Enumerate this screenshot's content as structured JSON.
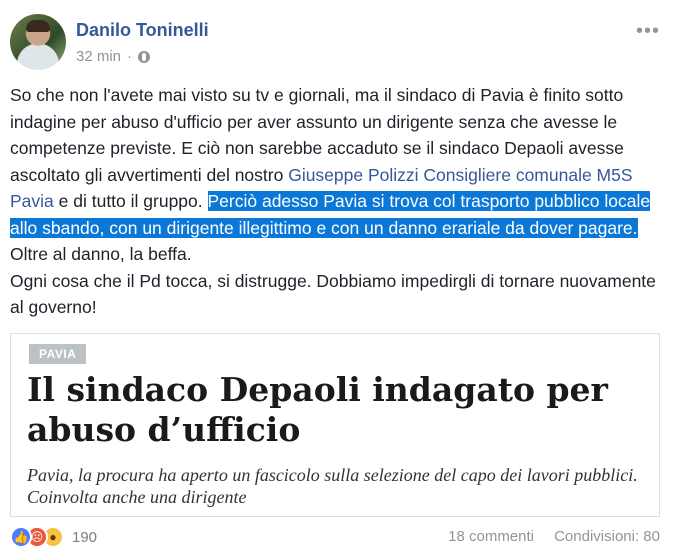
{
  "post": {
    "author": "Danilo Toninelli",
    "time": "32 min",
    "privacy_icon": "globe-icon",
    "more_icon": "ellipsis-icon",
    "text": {
      "part1": "So che non l'avete mai visto su tv e giornali, ma il sindaco di Pavia è finito sotto indagine per abuso d'ufficio per aver assunto un dirigente senza che avesse le competenze previste. E ciò non sarebbe accaduto se il sindaco Depaoli avesse ascoltato gli avvertimenti del nostro ",
      "link": "Giuseppe Polizzi Consigliere comunale M5S Pavia",
      "part2": " e di tutto il gruppo. ",
      "highlighted": "Perciò adesso Pavia si trova col trasporto pubblico locale allo sbando, con un dirigente illegittimo e con un danno erariale da dover pagare.",
      "part3": " Oltre al danno, la beffa.",
      "line_last": "Ogni cosa che il Pd tocca, si distrugge. Dobbiamo impedirgli di tornare nuovamente al governo!"
    }
  },
  "card": {
    "tag": "PAVIA",
    "title": "Il sindaco Depaoli indagato per abuso d’ufficio",
    "subtitle": "Pavia, la procura ha aperto un fascicolo sulla selezione del capo dei lavori pubblici. Coinvolta anche una dirigente"
  },
  "footer": {
    "reactions": [
      "like-icon",
      "angry-icon",
      "wow-icon"
    ],
    "reaction_count": "190",
    "comments": "18 commenti",
    "shares": "Condivisioni: 80"
  },
  "colors": {
    "author": "#365899",
    "highlight": "#0b78d8",
    "meta": "#90949c"
  }
}
